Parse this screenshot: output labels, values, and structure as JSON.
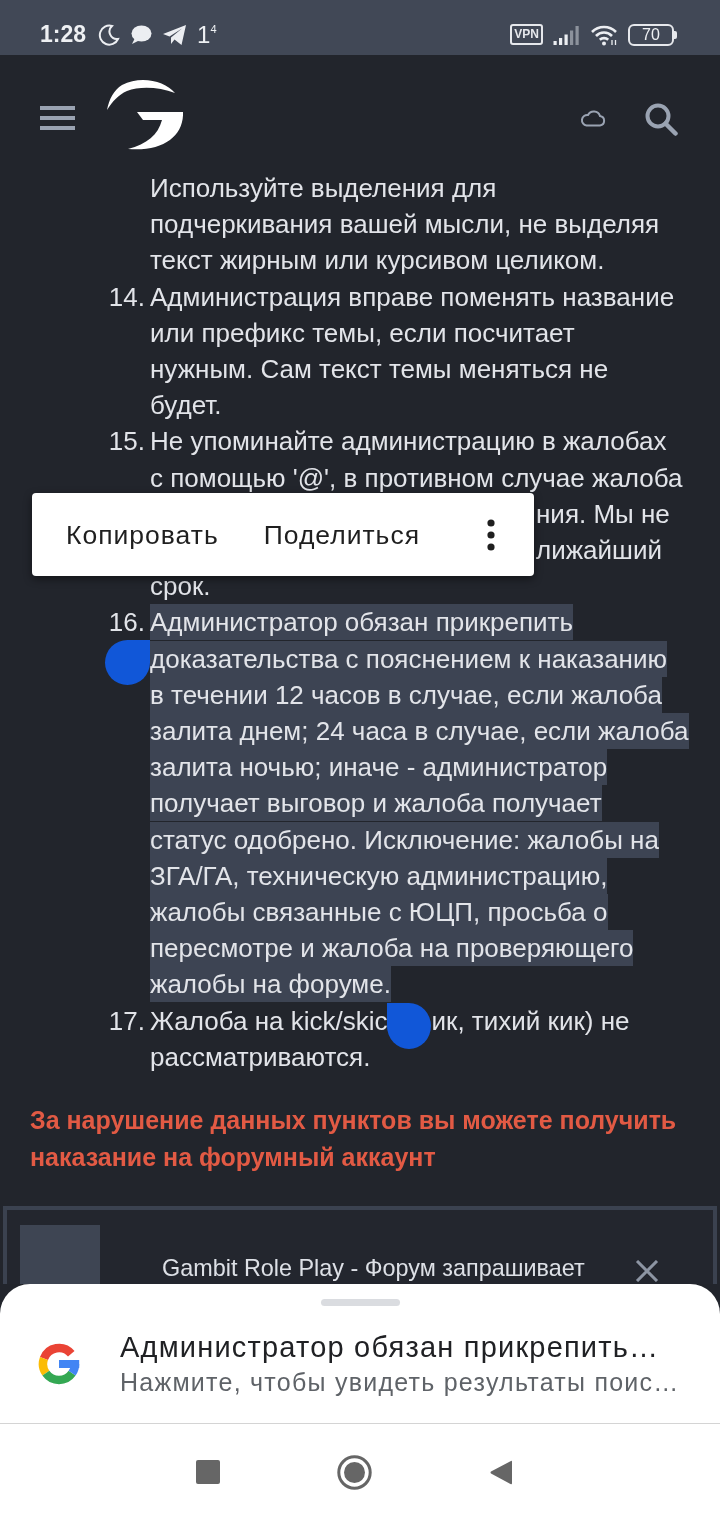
{
  "status_bar": {
    "time": "1:28",
    "indicator": "1$^{4}$",
    "vpn": "VPN",
    "battery": "70"
  },
  "rules": [
    {
      "kind": "plain",
      "text": "Используйте выделения для\nподчеркивания вашей мысли, не выделяя\nтекст жирным или курсивом целиком.",
      "selected": false
    },
    {
      "kind": "plain",
      "number": "14.",
      "text": "Администрация вправе поменять название\nили префикс темы, если посчитает\nнужным. Сам текст темы меняться не\nбудет.",
      "selected": false
    },
    {
      "kind": "covered",
      "number": "15.",
      "text": "Не упоминайте администрацию в жалобах\nс помощью '@', в противном случае жалоба",
      "visible_ends": [
        "ния. Мы не",
        "лижайший"
      ],
      "text_after": "срок.",
      "selected": false
    },
    {
      "kind": "plain",
      "number": "16.",
      "text": "Администратор обязан прикрепить\nдоказательства с пояснением к наказанию\nв течении 12 часов в случае, если жалоба\nзалита днем; 24 часа в случае, если жалоба\nзалита ночью; иначе - администратор\nполучает выговор и жалоба получает\nстатус одобрено. Исключение: жалобы на\nЗГА/ГА, техническую администрацию,\nжалобы связанные с ЮЦП, просьба о\nпересмотре и жалоба на проверяющего\nжалобы на форуме.",
      "selected": true
    },
    {
      "kind": "split",
      "number": "17.",
      "text_parts": [
        "Жалоба на kick/skic",
        "ик, тихий кик) не\nрассматриваются."
      ],
      "selected": false
    }
  ],
  "warning": "За нарушение данных пунктов вы можете получить наказание на форумный аккаунт",
  "selection_toolbar": {
    "actions": [
      "Копировать",
      "Поделиться"
    ]
  },
  "consent_banner": {
    "text": "Gambit Role Play - Форум запрашивает"
  },
  "search_sheet": {
    "title": "Администратор обязан прикрепить…",
    "subtitle": "Нажмите, чтобы увидеть результаты поис…"
  }
}
